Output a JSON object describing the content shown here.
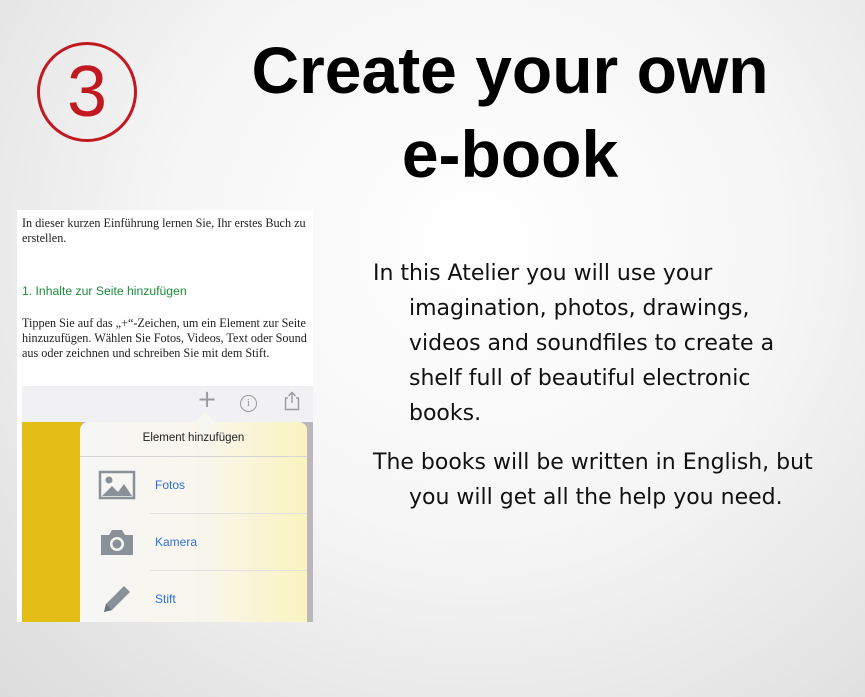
{
  "slide": {
    "number": "3",
    "title_line1": "Create your own",
    "title_line2": "e-book",
    "paragraph1": "In this Atelier you will use your imagination, photos, drawings, videos and soundfiles to create a shelf full of beautiful electronic books.",
    "paragraph2": "The books will be written in English, but you will get all the help you need."
  },
  "screenshot": {
    "intro": "In dieser kurzen Einführung lernen Sie, Ihr erstes Buch zu erstellen.",
    "heading": "1. Inhalte zur Seite hinzufügen",
    "paragraph": "Tippen Sie auf das „+“-Zeichen, um ein Element zur Seite hinzuzufügen. Wählen Sie Fotos, Videos, Text oder Sound aus oder zeichnen und schreiben Sie mit dem Stift.",
    "toolbar": {
      "plus_icon": "plus-icon",
      "info_icon": "info-icon",
      "share_icon": "share-icon"
    },
    "popover": {
      "title": "Element hinzufügen",
      "items": [
        {
          "label": "Fotos",
          "icon": "photo-icon"
        },
        {
          "label": "Kamera",
          "icon": "camera-icon"
        },
        {
          "label": "Stift",
          "icon": "pencil-icon"
        }
      ]
    }
  },
  "colors": {
    "accent_red": "#c0191f",
    "heading_green": "#1e8a3a",
    "link_blue": "#2f6fd6",
    "yellow": "#e3bd16"
  }
}
